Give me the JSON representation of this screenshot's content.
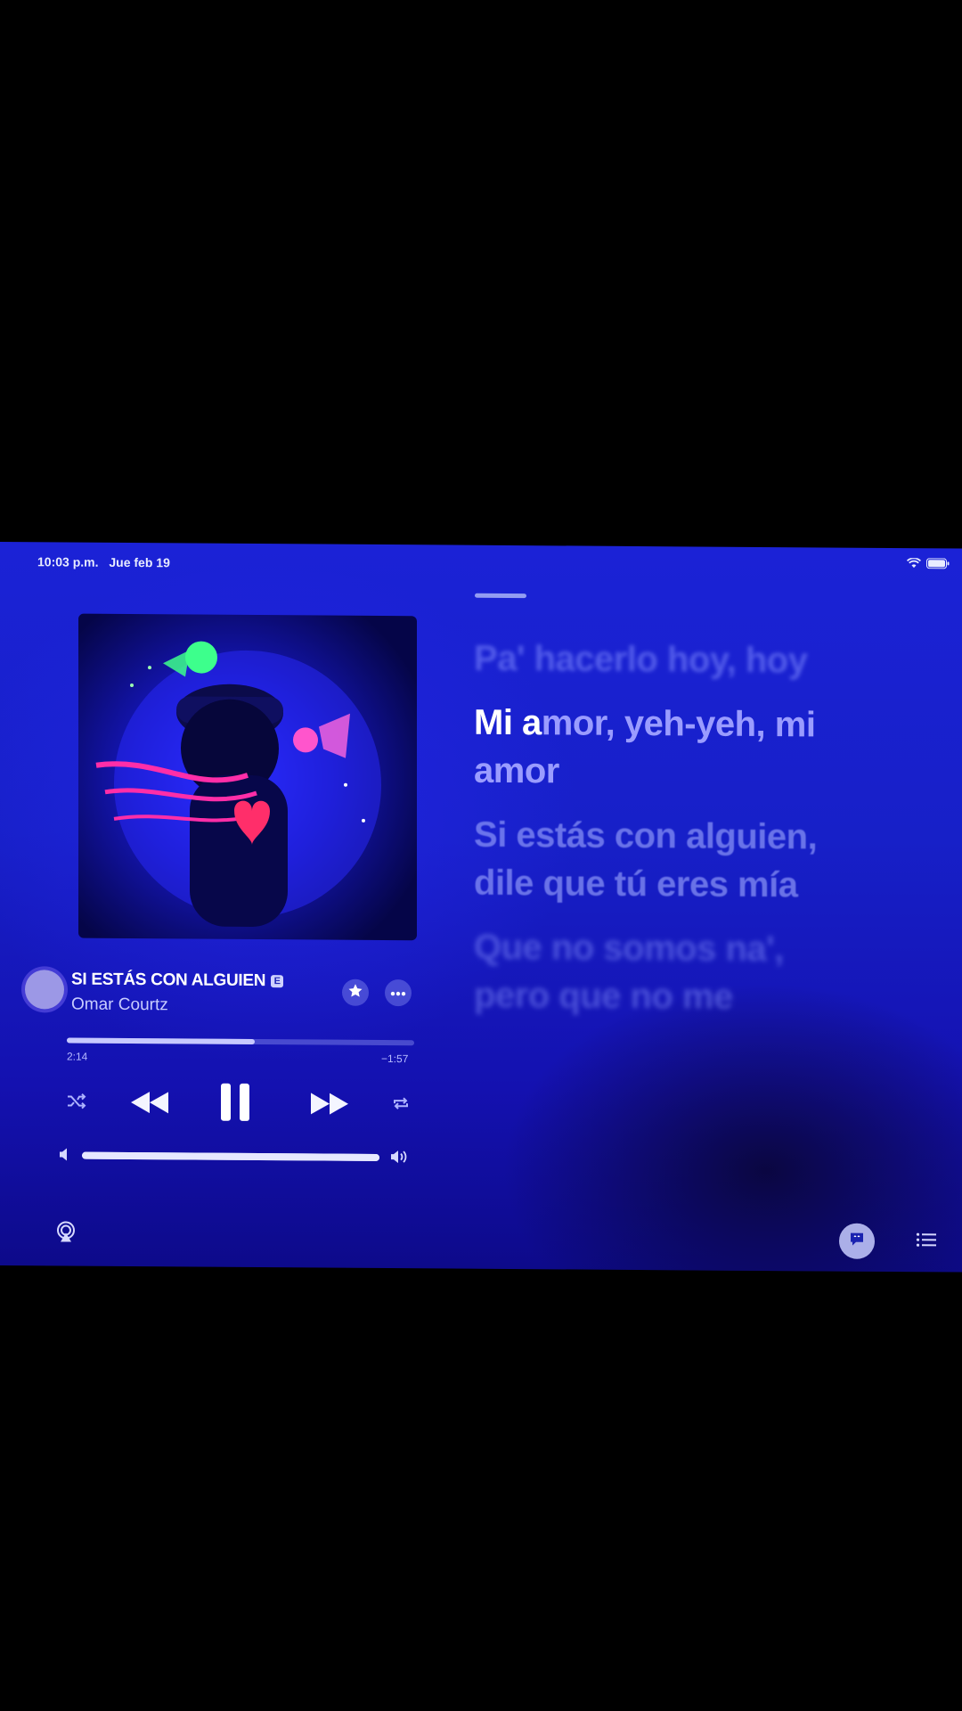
{
  "status": {
    "time": "10:03 p.m.",
    "date": "Jue feb 19",
    "wifi_icon": "wifi-icon",
    "battery_icon": "battery-icon"
  },
  "now_playing": {
    "title": "SI ESTÁS CON ALGUIEN",
    "explicit_badge": "E",
    "artist": "Omar Courtz",
    "progress_fraction": 0.54,
    "elapsed": "2:14",
    "remaining": "−1:57",
    "volume_fraction": 1.0
  },
  "lyrics": {
    "past_line": "Pa' hacerlo hoy, hoy",
    "active_sung": "Mi a",
    "active_rest": "mor, yeh-yeh, mi amor",
    "next_line": "Si estás con alguien, dile que tú eres mía",
    "far_line": "Que no somos na', pero que no me"
  },
  "icons": {
    "shuffle": "shuffle-icon",
    "rewind": "rewind-icon",
    "pause": "pause-icon",
    "forward": "fast-forward-icon",
    "repeat": "repeat-icon",
    "favorite": "star-icon",
    "more": "more-icon",
    "airplay": "airplay-icon",
    "lyrics": "lyrics-icon",
    "queue": "queue-icon"
  },
  "colors": {
    "accent": "#1b22d6",
    "text": "#ffffff"
  }
}
